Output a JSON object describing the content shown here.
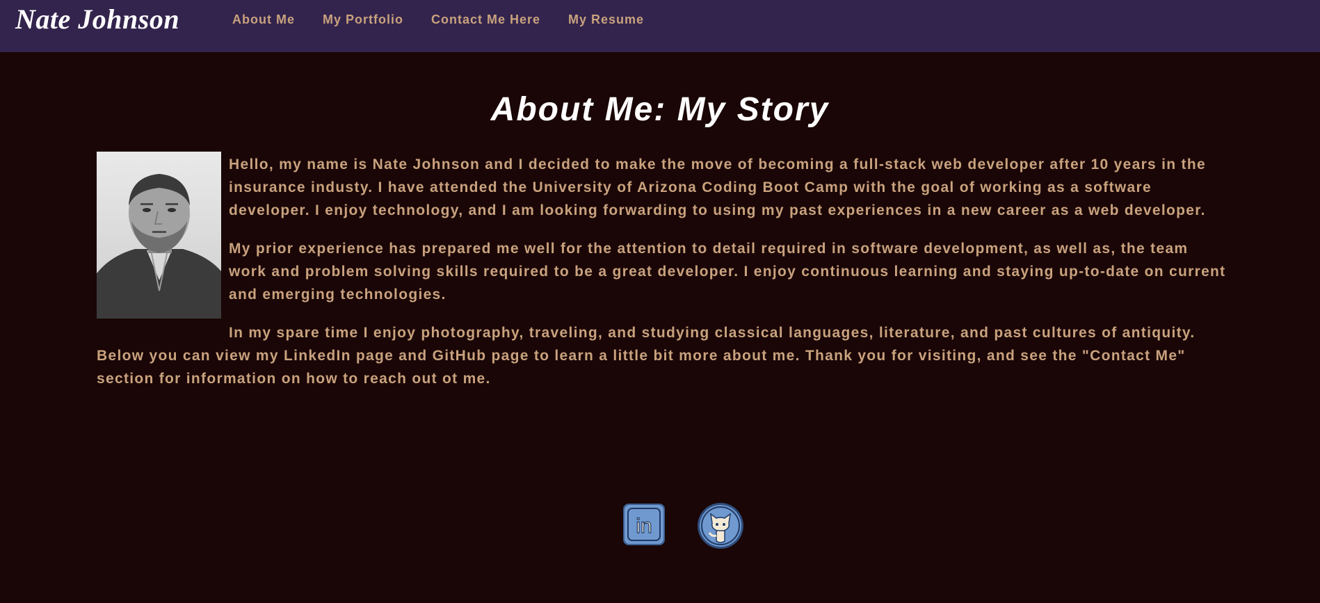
{
  "brand": "Nate Johnson",
  "nav": {
    "items": [
      "About Me",
      "My Portfolio",
      "Contact Me Here",
      "My Resume"
    ]
  },
  "page": {
    "title": "About Me: My Story"
  },
  "about": {
    "paragraphs": [
      "Hello, my name is Nate Johnson and I decided to make the move of becoming a full-stack web developer after 10 years in the insurance industy. I have attended the University of Arizona Coding Boot Camp with the goal of working as a software developer. I enjoy technology, and I am looking forwarding to using my past experiences in a new career as a web developer.",
      "My prior experience has prepared me well for the attention to detail required in software development, as well as, the team work and problem solving skills required to be a great developer. I enjoy continuous learning and staying up-to-date on current and emerging technologies.",
      "In my spare time I enjoy photography, traveling, and studying classical languages, literature, and past cultures of antiquity. Below you can view my LinkedIn page and GitHub page to learn a little bit more about me. Thank you for visiting, and see the \"Contact Me\" section for information on how to reach out ot me."
    ]
  },
  "social": {
    "linkedin_text": "in",
    "linkedin_icon": "linkedin-icon",
    "github_icon": "github-icon"
  },
  "colors": {
    "background": "#1a0606",
    "topbar": "#33244d",
    "accent_text": "#c9a27e",
    "icon_fill": "#6f99cf"
  }
}
